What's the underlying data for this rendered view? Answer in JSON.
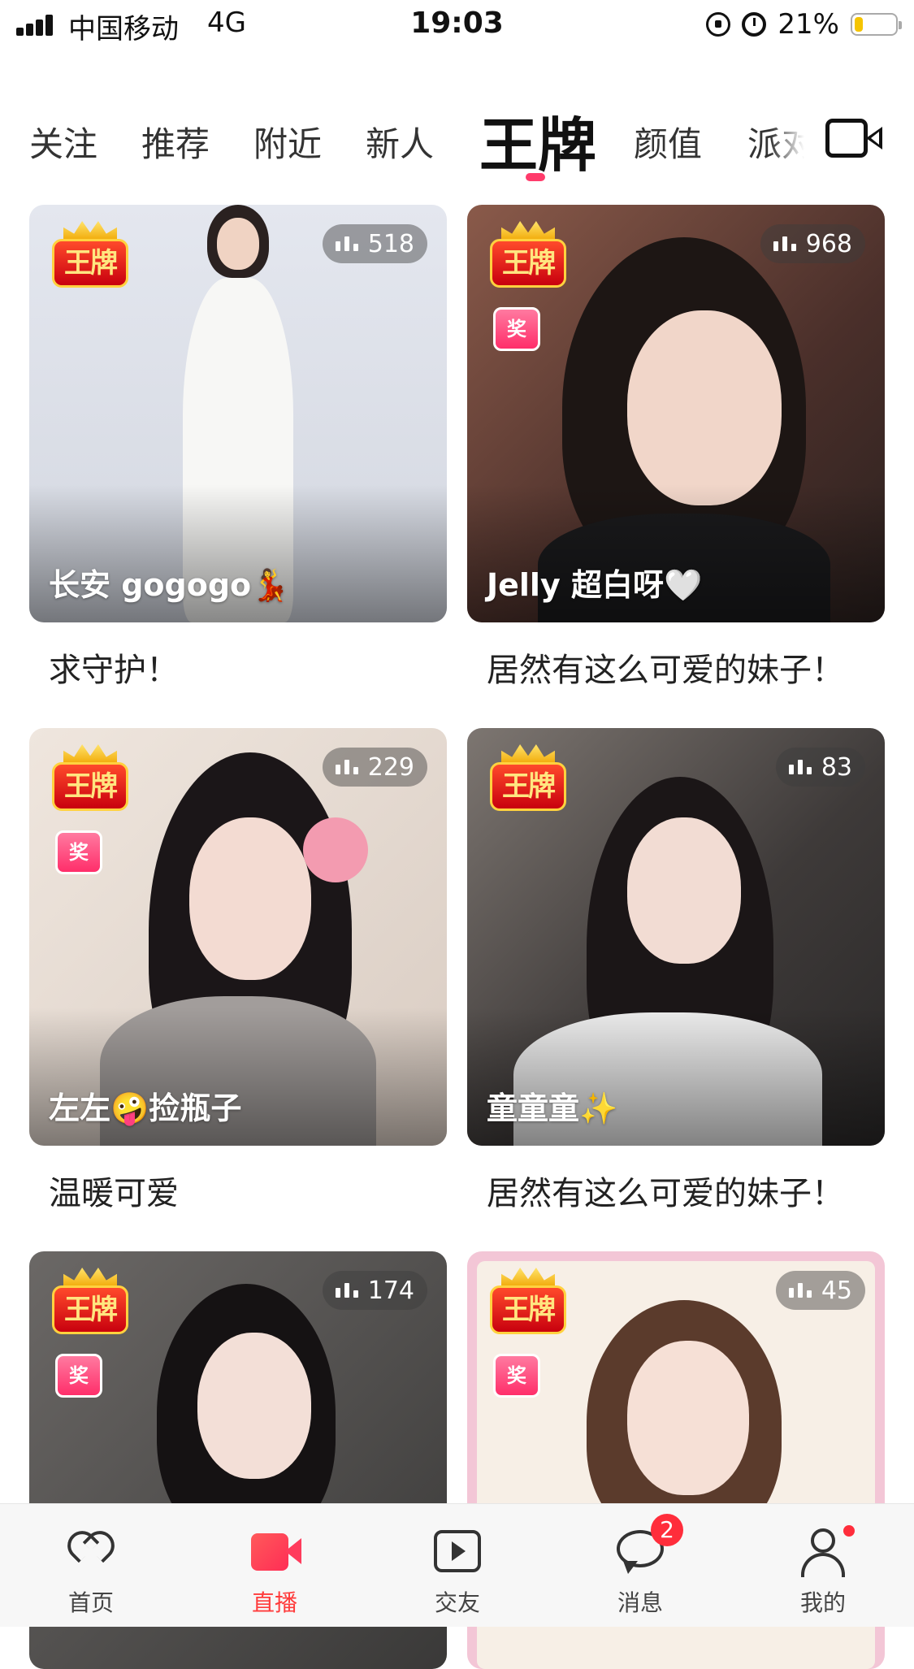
{
  "status_bar": {
    "carrier": "中国移动",
    "network": "4G",
    "time": "19:03",
    "battery": "21%",
    "battery_level": 0.21
  },
  "tabs": [
    "关注",
    "推荐",
    "附近",
    "新人",
    "王牌",
    "颜值",
    "派对"
  ],
  "active_tab": "王牌",
  "badges": {
    "wang": "王牌",
    "jiang": "奖"
  },
  "cards": [
    {
      "name": "长安 gogogo💃",
      "viewers": "518",
      "caption": "求守护！",
      "has_jiang": false
    },
    {
      "name": "Jelly 超白呀🤍",
      "viewers": "968",
      "caption": "居然有这么可爱的妹子！",
      "has_jiang": true
    },
    {
      "name": "左左🤪捡瓶子",
      "viewers": "229",
      "caption": "温暖可爱",
      "has_jiang": true
    },
    {
      "name": "童童童✨",
      "viewers": "83",
      "caption": "居然有这么可爱的妹子！",
      "has_jiang": true
    },
    {
      "name": "",
      "viewers": "174",
      "caption": "",
      "has_jiang": true
    },
    {
      "name": "",
      "viewers": "45",
      "caption": "",
      "has_jiang": true
    }
  ],
  "bottom_nav": [
    {
      "label": "首页",
      "icon": "heart-icon"
    },
    {
      "label": "直播",
      "icon": "video-camera-icon"
    },
    {
      "label": "交友",
      "icon": "play-icon"
    },
    {
      "label": "消息",
      "icon": "chat-bubble-icon"
    },
    {
      "label": "我的",
      "icon": "user-icon"
    }
  ],
  "active_nav": "直播",
  "message_badge": "2",
  "colors": {
    "accent": "#ff3b6b",
    "nav_active": "#ff3b3b",
    "badge": "#ff2d3b"
  }
}
